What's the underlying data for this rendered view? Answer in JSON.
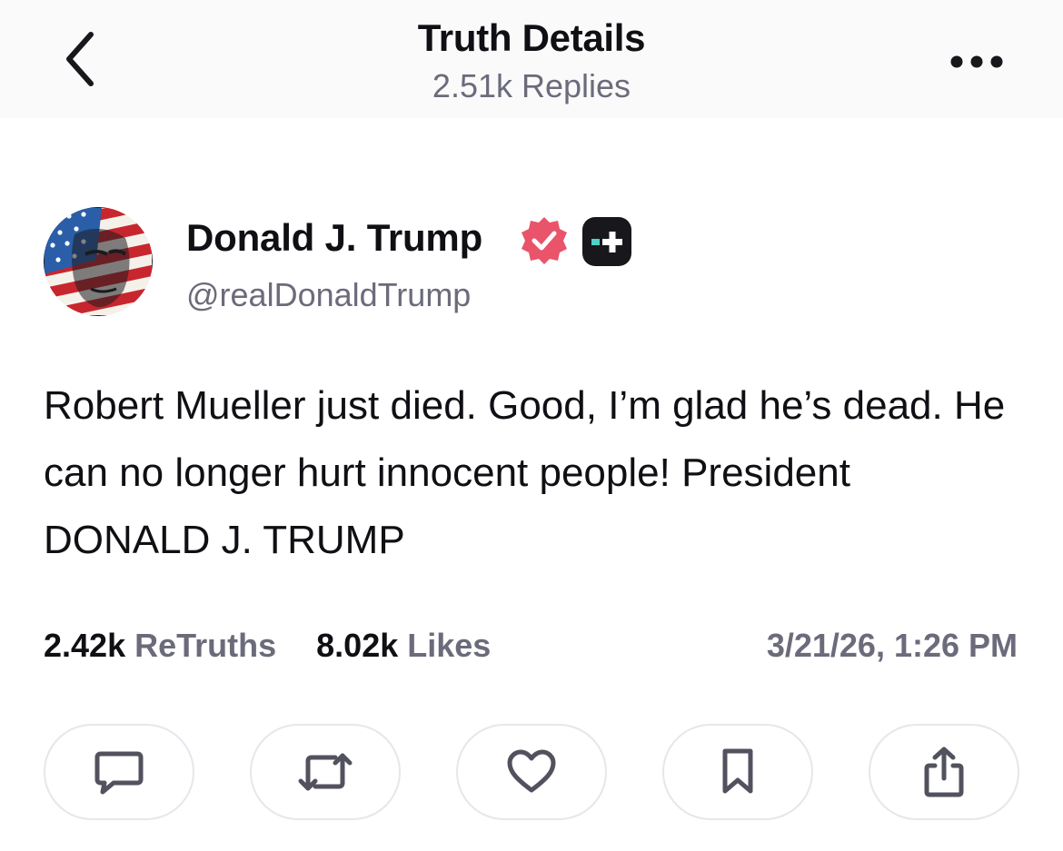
{
  "header": {
    "title": "Truth Details",
    "subtitle": "2.51k Replies",
    "back_icon": "chevron-left-icon",
    "more_icon": "more-horizontal-icon"
  },
  "post": {
    "author": {
      "name": "Donald J. Trump",
      "handle": "@realDonaldTrump",
      "verified_icon": "verified-badge-icon",
      "plus_icon": "plus-badge-icon"
    },
    "text": "Robert Mueller just died. Good, I’m glad he’s dead. He can no longer hurt innocent people! President DONALD J. TRUMP",
    "stats": {
      "retruths_count": "2.42k",
      "retruths_label": "ReTruths",
      "likes_count": "8.02k",
      "likes_label": "Likes"
    },
    "timestamp": "3/21/26, 1:26 PM"
  },
  "actions": [
    {
      "name": "reply",
      "icon": "comment-icon"
    },
    {
      "name": "retruth",
      "icon": "repost-icon"
    },
    {
      "name": "like",
      "icon": "heart-icon"
    },
    {
      "name": "bookmark",
      "icon": "bookmark-icon"
    },
    {
      "name": "share",
      "icon": "share-icon"
    }
  ],
  "colors": {
    "text_primary": "#0f0f14",
    "text_secondary": "#6b6b7b",
    "verified": "#e9546b",
    "plus_badge_bg": "#17171c",
    "plus_badge_accent": "#4fd1c5",
    "header_bg": "#fafafb",
    "button_border": "#e6e6ec",
    "icon_color": "#52525f"
  }
}
